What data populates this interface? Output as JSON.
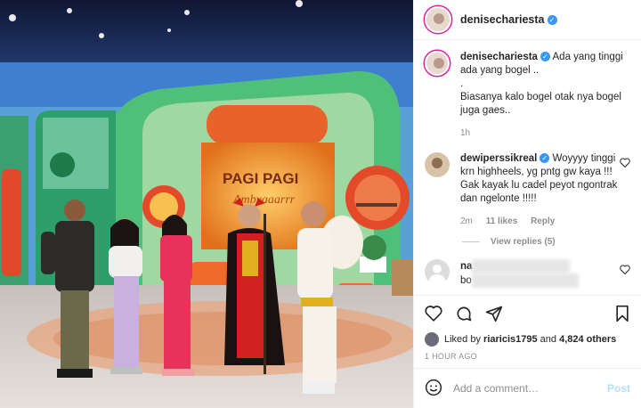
{
  "post": {
    "author": "denisechariesta",
    "caption": {
      "user": "denisechariesta",
      "text": "Ada yang tinggi ada yang bogel ..\n.\nBiasanya kalo bogel otak nya bogel juga gaes..",
      "age": "1h"
    },
    "photo_text": {
      "sign_line1": "PAGI PAGI",
      "sign_line2": "Ambyaaarrr"
    },
    "comments": [
      {
        "user": "dewiperssikreal",
        "text": "Woyyyy tinggi krn highheels, yg pntg gw kaya !!! Gak kayak lu cadel peyot ngontrak dan ngelonte !!!!!",
        "age": "2m",
        "likes": "11 likes",
        "reply": "Reply",
        "view_replies": "View replies (5)"
      },
      {
        "user": "na",
        "text": "bo"
      }
    ],
    "likes": {
      "prefix": "Liked by",
      "user": "riaricis1795",
      "connector": "and",
      "others": "4,824 others"
    },
    "timestamp": "1 HOUR AGO",
    "add_comment": {
      "placeholder": "Add a comment…",
      "post_label": "Post"
    }
  },
  "colors": {
    "verified": "#3897f0",
    "post_disabled": "#b2dffc",
    "muted": "#8e8e8e"
  },
  "icons": [
    "verified-icon",
    "heart-icon",
    "comment-icon",
    "share-icon",
    "save-icon",
    "emoji-icon"
  ]
}
